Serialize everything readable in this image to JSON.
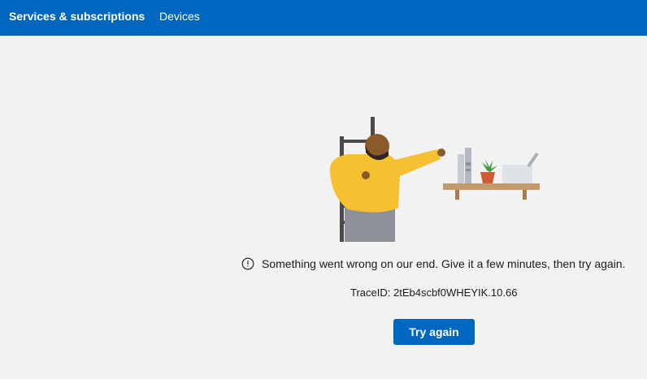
{
  "nav": {
    "tabs": [
      {
        "label": "Services & subscriptions",
        "active": true
      },
      {
        "label": "Devices",
        "active": false
      }
    ]
  },
  "error": {
    "icon": "info-circle-icon",
    "message": "Something went wrong on our end. Give it a few minutes, then try again.",
    "trace": "TraceID: 2tEb4scbf0WHEYIK.10.66",
    "retry_label": "Try again"
  },
  "colors": {
    "accent": "#0067c0",
    "background": "#f2f2f2",
    "text": "#1a1a1a"
  }
}
